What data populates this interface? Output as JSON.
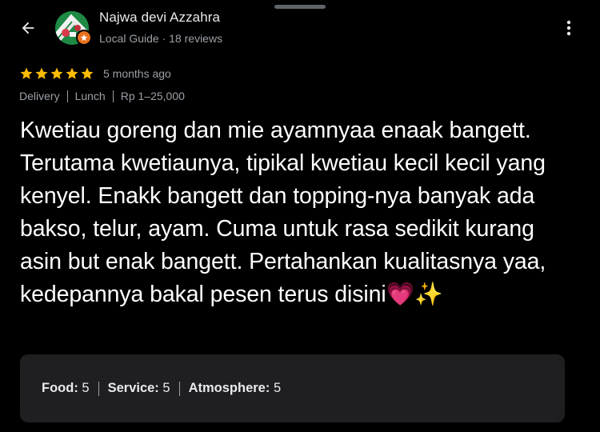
{
  "header": {
    "back_icon": "arrow-back-icon",
    "more_icon": "more-vert-icon",
    "user_name": "Najwa devi Azzahra",
    "user_meta": "Local Guide · 18 reviews",
    "badge_icon": "local-guide-star-icon"
  },
  "review": {
    "rating": 5,
    "rating_max": 5,
    "star_color": "#fbbc04",
    "time_ago": "5 months ago",
    "tags": [
      "Delivery",
      "Lunch",
      "Rp 1–25,000"
    ],
    "text": "Kwetiau goreng dan mie ayamnyaa enaak bangett. Terutama kwetiaunya, tipikal kwetiau kecil kecil yang kenyel. Enakk bangett dan topping-nya banyak ada bakso, telur, ayam. Cuma untuk rasa sedikit kurang asin but enak bangett. Pertahankan kualitasnya yaa, kedepannya bakal pesen terus disini💗✨"
  },
  "ratings_card": {
    "items": [
      {
        "label": "Food:",
        "value": "5"
      },
      {
        "label": "Service:",
        "value": "5"
      },
      {
        "label": "Atmosphere:",
        "value": "5"
      }
    ]
  },
  "colors": {
    "background": "#000000",
    "card": "#1f1f21",
    "secondary_text": "#9aa0a6",
    "badge": "#e8711f"
  }
}
